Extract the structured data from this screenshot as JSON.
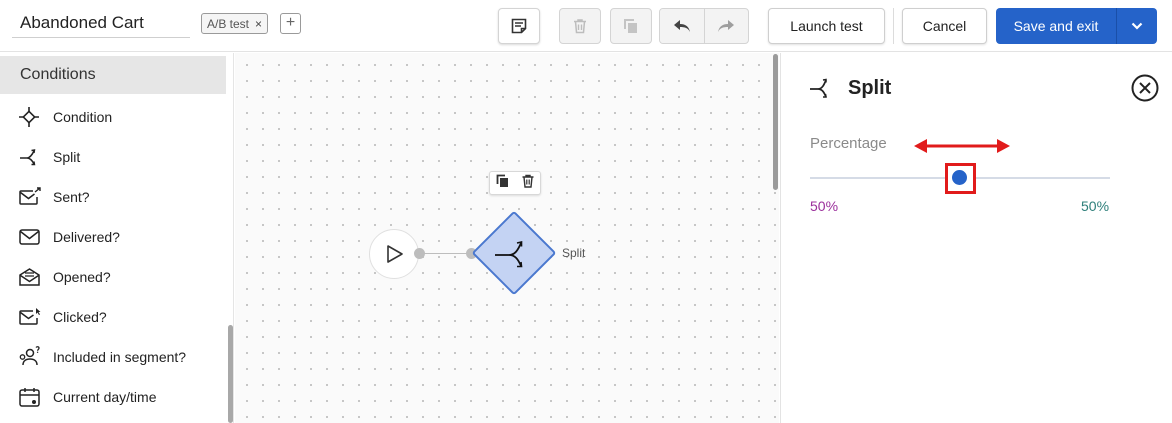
{
  "header": {
    "title_value": "Abandoned Cart",
    "tag_label": "A/B test",
    "tag_remove": "×",
    "tag_add": "+",
    "launch_label": "Launch test",
    "cancel_label": "Cancel",
    "save_label": "Save and exit",
    "primary_color": "#2563c9"
  },
  "sidebar": {
    "heading": "Conditions",
    "items": [
      {
        "label": "Condition",
        "icon": "condition-icon"
      },
      {
        "label": "Split",
        "icon": "split-icon"
      },
      {
        "label": "Sent?",
        "icon": "mail-sent-icon"
      },
      {
        "label": "Delivered?",
        "icon": "mail-delivered-icon"
      },
      {
        "label": "Opened?",
        "icon": "mail-opened-icon"
      },
      {
        "label": "Clicked?",
        "icon": "mail-clicked-icon"
      },
      {
        "label": "Included in segment?",
        "icon": "segment-icon"
      },
      {
        "label": "Current day/time",
        "icon": "calendar-icon"
      }
    ]
  },
  "canvas": {
    "split_node_label": "Split"
  },
  "panel": {
    "title": "Split",
    "percentage_label": "Percentage",
    "left_value": "50%",
    "right_value": "50%",
    "left_color": "#9b2f9b",
    "right_color": "#2e7f7a",
    "highlight_color": "#e11b1b",
    "slider_value_percent": 50
  }
}
